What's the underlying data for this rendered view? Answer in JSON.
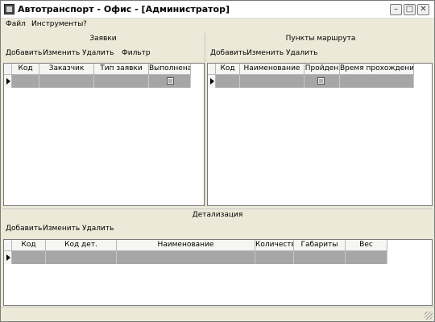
{
  "window": {
    "title": "Автотранспорт - Офис - [Администратор]"
  },
  "menu": [
    {
      "label": "Файл"
    },
    {
      "label": "Инструменты"
    },
    {
      "label": "?"
    }
  ],
  "orders": {
    "header": "Заявки",
    "toolbar": [
      "Добавить",
      "Изменить",
      "Удалить",
      "Фильтр"
    ],
    "columns": [
      "Код",
      "Заказчик",
      "Тип заявки",
      "Выполнена"
    ]
  },
  "route": {
    "header": "Пункты маршрута",
    "toolbar": [
      "Добавить",
      "Изменить",
      "Удалить"
    ],
    "columns": [
      "Код",
      "Наименование",
      "Пройден",
      "Время прохождения"
    ]
  },
  "details": {
    "header": "Детализация",
    "toolbar": [
      "Добавить",
      "Изменить",
      "Удалить"
    ],
    "columns": [
      "Код",
      "Код дет.",
      "Наименование",
      "Количество",
      "Габариты",
      "Вес"
    ]
  }
}
